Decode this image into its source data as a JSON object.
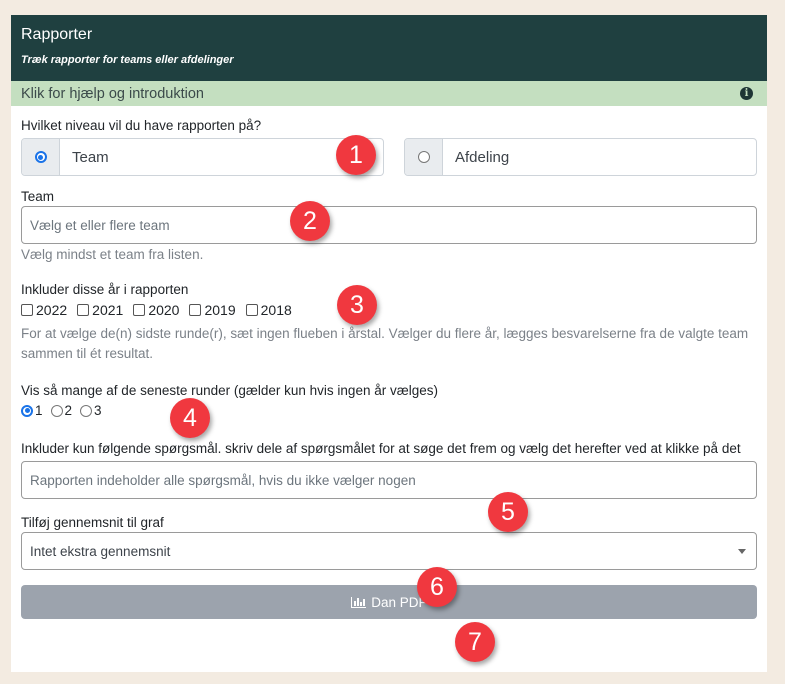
{
  "header": {
    "title": "Rapporter",
    "subtitle": "Træk rapporter for teams eller afdelinger"
  },
  "help_bar": {
    "label": "Klik for hjælp og introduktion",
    "icon": "info-icon"
  },
  "level": {
    "label": "Hvilket niveau vil du have rapporten på?",
    "options": [
      {
        "label": "Team",
        "checked": true
      },
      {
        "label": "Afdeling",
        "checked": false
      }
    ]
  },
  "team": {
    "label": "Team",
    "placeholder": "Vælg et eller flere team",
    "hint": "Vælg mindst et team fra listen."
  },
  "years": {
    "label": "Inkluder disse år i rapporten",
    "options": [
      {
        "label": "2022",
        "checked": false
      },
      {
        "label": "2021",
        "checked": false
      },
      {
        "label": "2020",
        "checked": false
      },
      {
        "label": "2019",
        "checked": false
      },
      {
        "label": "2018",
        "checked": false
      }
    ],
    "hint": "For at vælge de(n) sidste runde(r), sæt ingen flueben i årstal. Vælger du flere år, lægges besvarelserne fra de valgte team sammen til ét resultat."
  },
  "rounds": {
    "label": "Vis så mange af de seneste runder (gælder kun hvis ingen år vælges)",
    "options": [
      {
        "label": "1",
        "checked": true
      },
      {
        "label": "2",
        "checked": false
      },
      {
        "label": "3",
        "checked": false
      }
    ]
  },
  "questions": {
    "label": "Inkluder kun følgende spørgsmål. skriv dele af spørgsmålet for at søge det frem og vælg det herefter ved at klikke på det",
    "placeholder": "Rapporten indeholder alle spørgsmål, hvis du ikke vælger nogen"
  },
  "average": {
    "label": "Tilføj gennemsnit til graf",
    "selected": "Intet ekstra gennemsnit"
  },
  "submit": {
    "label": "Dan PDF",
    "icon": "bar-chart-icon"
  },
  "badges": [
    "1",
    "2",
    "3",
    "4",
    "5",
    "6",
    "7"
  ],
  "colors": {
    "header_bg": "#1f4040",
    "help_bg": "#c4dfc0",
    "badge": "#f0383f",
    "button": "#9ca3ad",
    "page_bg": "#f3ebe1"
  }
}
